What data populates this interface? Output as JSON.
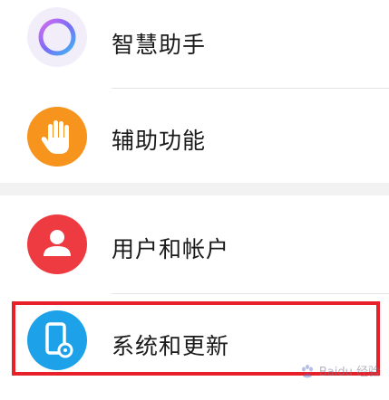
{
  "settings": {
    "items": [
      {
        "label": "智慧助手",
        "icon": "assistant-ring-icon",
        "color": "#8a6cf0"
      },
      {
        "label": "辅助功能",
        "icon": "hand-icon",
        "color": "#f7941d"
      },
      {
        "label": "用户和帐户",
        "icon": "user-icon",
        "color": "#ee3b41"
      },
      {
        "label": "系统和更新",
        "icon": "phone-settings-icon",
        "color": "#1da1e8"
      }
    ]
  },
  "highlight_color": "#e8202a",
  "watermark": {
    "text": "Baidu 经验"
  }
}
